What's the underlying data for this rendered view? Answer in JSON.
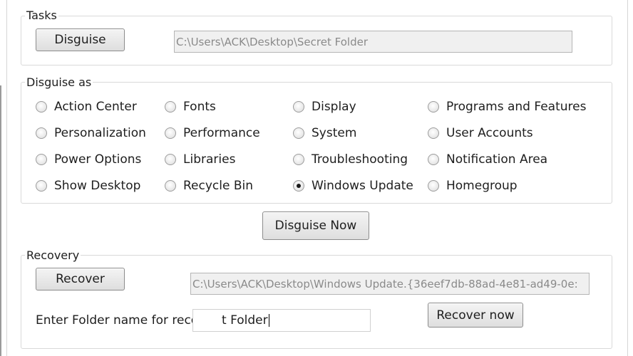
{
  "tasks": {
    "title": "Tasks",
    "disguise_label": "Disguise",
    "folder_path": "C:\\Users\\ACK\\Desktop\\Secret Folder"
  },
  "disguise_as": {
    "title": "Disguise as",
    "options": [
      {
        "label": "Action Center",
        "checked": false
      },
      {
        "label": "Fonts",
        "checked": false
      },
      {
        "label": "Display",
        "checked": false
      },
      {
        "label": "Programs and Features",
        "checked": false
      },
      {
        "label": "Personalization",
        "checked": false
      },
      {
        "label": "Performance",
        "checked": false
      },
      {
        "label": "System",
        "checked": false
      },
      {
        "label": "User Accounts",
        "checked": false
      },
      {
        "label": "Power Options",
        "checked": false
      },
      {
        "label": "Libraries",
        "checked": false
      },
      {
        "label": "Troubleshooting",
        "checked": false
      },
      {
        "label": "Notification Area",
        "checked": false
      },
      {
        "label": "Show Desktop",
        "checked": false
      },
      {
        "label": "Recycle Bin",
        "checked": false
      },
      {
        "label": "Windows Update",
        "checked": true
      },
      {
        "label": "Homegroup",
        "checked": false
      }
    ],
    "disguise_now_label": "Disguise Now"
  },
  "recovery": {
    "title": "Recovery",
    "recover_label": "Recover",
    "recovered_path": "C:\\Users\\ACK\\Desktop\\Windows Update.{36eef7db-88ad-4e81-ad49-0e:",
    "folder_name_prompt": "Enter Folder name for recovery",
    "folder_name_value": "t Folder",
    "recover_now_label": "Recover now"
  }
}
